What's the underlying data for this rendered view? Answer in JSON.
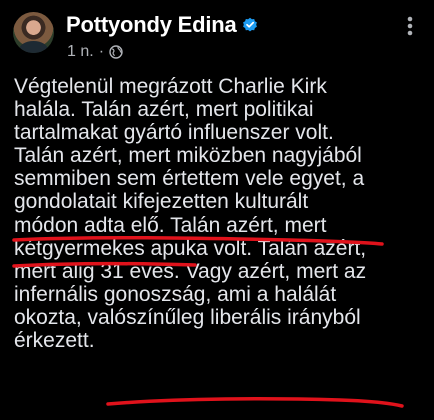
{
  "post": {
    "author": "Pottyondy Edina",
    "time": "1 n.",
    "separator": "·",
    "verified_icon": "verified-badge-icon",
    "audience_icon": "globe-icon",
    "more_icon": "more-options-icon",
    "lines": [
      "Végtelenül megrázott Charlie Kirk",
      "halála. Talán azért, mert politikai",
      "tartalmakat gyártó influenszer volt.",
      "Talán azért, mert miközben nagyjából",
      "semmiben sem értettem vele egyet, a",
      "gondolatait kifejezetten kulturált",
      "módon adta elő. Talán azért, mert",
      "kétgyermekes apuka volt. Talán azért,",
      "mert alig 31 éves. Vagy azért, mert az",
      "infernális gonoszság, ami a halálát",
      "okozta, valószínűleg liberális irányból",
      "érkezett."
    ]
  },
  "colors": {
    "background": "#000000",
    "text": "#e4e6eb",
    "secondary_text": "#b0b3b8",
    "verified": "#1d9bf0",
    "annotation": "#e0121b"
  }
}
